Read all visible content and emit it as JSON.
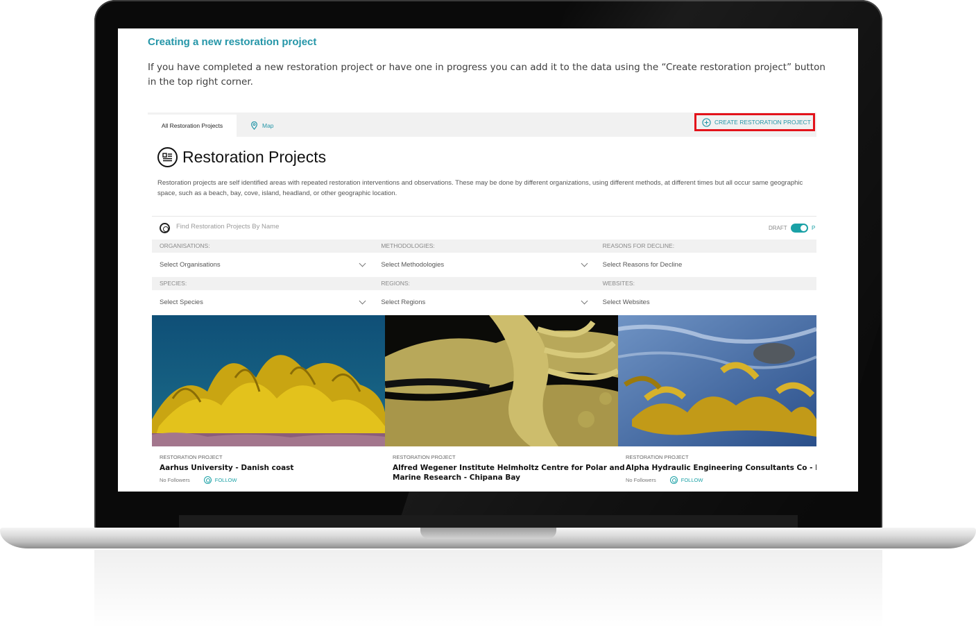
{
  "doc": {
    "heading": "Creating a new restoration project",
    "paragraph": "If you have completed a new restoration project or have one in progress you can add it to the data using the “Create restoration project” button in the top right corner."
  },
  "app": {
    "tabs": [
      {
        "label": "All Restoration Projects",
        "icon": "none"
      },
      {
        "label": "Map",
        "icon": "map-pin-icon"
      }
    ],
    "create_button": {
      "label": "CREATE RESTORATION PROJECT",
      "icon": "plus-circle-icon",
      "highlight_color": "#e3131b"
    },
    "page_title": "Restoration Projects",
    "description": "Restoration projects are self identified areas with repeated restoration interventions and observations. These may be done by different organizations, using different methods, at different times but all occur same geographic space, such as a beach, bay, cove, island, headland, or other geographic location.",
    "search": {
      "placeholder": "Find Restoration Projects By Name",
      "icon": "search-icon"
    },
    "toggle": {
      "label": "DRAFT",
      "state_label": "P",
      "on": true
    },
    "filters": [
      {
        "label": "ORGANISATIONS:",
        "placeholder": "Select Organisations"
      },
      {
        "label": "METHODOLOGIES:",
        "placeholder": "Select Methodologies"
      },
      {
        "label": "REASONS FOR DECLINE:",
        "placeholder": "Select Reasons for Decline"
      },
      {
        "label": "SPECIES:",
        "placeholder": "Select Species"
      },
      {
        "label": "REGIONS:",
        "placeholder": "Select Regions"
      },
      {
        "label": "WEBSITES:",
        "placeholder": "Select Websites"
      }
    ],
    "cards": [
      {
        "type": "RESTORATION PROJECT",
        "title": "Aarhus University - Danish coast",
        "followers": "No Followers",
        "follow": "FOLLOW",
        "image": "yellow kelp underwater"
      },
      {
        "type": "RESTORATION PROJECT",
        "title_line1": "Alfred Wegener Institute Helmholtz Centre for Polar and",
        "title_line2": "Marine Research - Chipana Bay",
        "image": "kelp blade close-up"
      },
      {
        "type": "RESTORATION PROJECT",
        "title": "Alpha Hydraulic Engineering Consultants Co - Hokka",
        "followers": "No Followers",
        "follow": "FOLLOW",
        "image": "kelp in shallow water"
      }
    ],
    "colors": {
      "accent": "#2596a8",
      "toggle": "#1aa1a6"
    }
  }
}
